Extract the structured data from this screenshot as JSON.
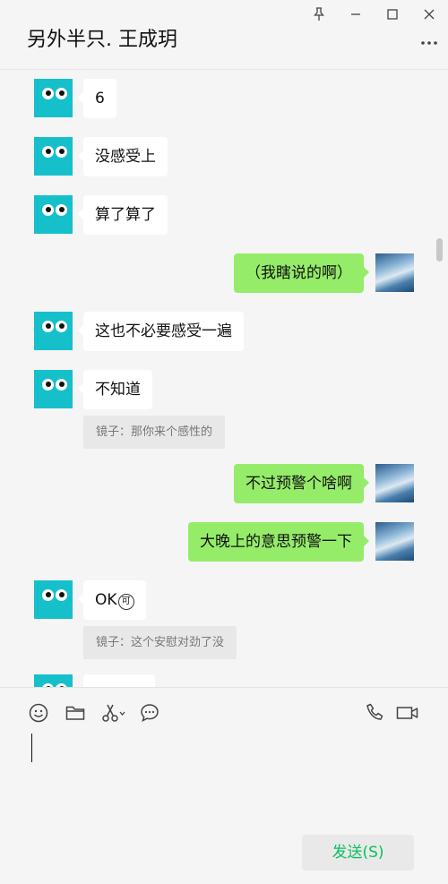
{
  "header": {
    "title": "另外半只. 王成玥"
  },
  "window_controls": {
    "pin_icon": "pin-icon",
    "minimize_icon": "minimize-icon",
    "maximize_icon": "maximize-icon",
    "close_icon": "close-icon",
    "more_icon": "more-icon"
  },
  "messages": [
    {
      "side": "in",
      "text": "6"
    },
    {
      "side": "in",
      "text": "没感受上"
    },
    {
      "side": "in",
      "text": "算了算了"
    },
    {
      "side": "out",
      "text": "（我瞎说的啊）"
    },
    {
      "side": "in",
      "text": "这也不必要感受一遍"
    },
    {
      "side": "in",
      "text": "不知道",
      "quote": "镜子：那你来个感性的"
    },
    {
      "side": "out",
      "text": "不过预警个啥啊"
    },
    {
      "side": "out",
      "text": "大晚上的意思预警一下"
    },
    {
      "side": "in",
      "text": "OK",
      "emoji": "可",
      "quote": "镜子：这个安慰对劲了没"
    }
  ],
  "toolbar": {
    "icons": [
      "emoji-icon",
      "folder-icon",
      "scissors-icon",
      "chat-history-icon",
      "phone-icon",
      "video-icon"
    ]
  },
  "composer": {
    "value": "",
    "send_label": "发送(S)"
  },
  "colors": {
    "accent": "#07c160",
    "out_bubble": "#95ec69",
    "avatar": "#16c0cb"
  }
}
